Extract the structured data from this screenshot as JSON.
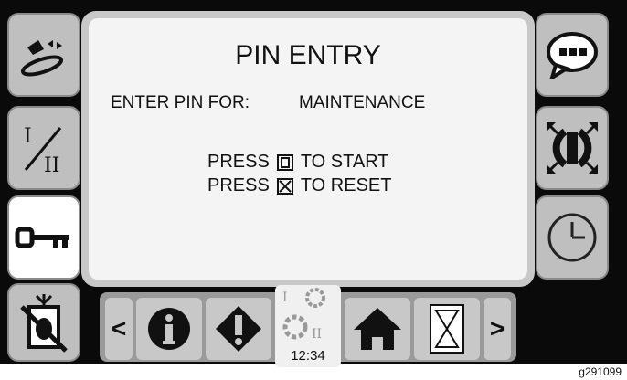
{
  "panel": {
    "title": "PIN ENTRY",
    "pin_label": "ENTER PIN FOR:",
    "pin_target": "MAINTENANCE",
    "press_word": "PRESS",
    "start_action": "TO START",
    "reset_action": "TO RESET"
  },
  "left_buttons": [
    {
      "icon": "conveyor-icon"
    },
    {
      "icon": "mode-switch-icon"
    },
    {
      "icon": "key-icon",
      "active": true
    },
    {
      "icon": "no-tamper-icon"
    }
  ],
  "right_buttons": [
    {
      "icon": "message-icon"
    },
    {
      "icon": "fullscreen-icon"
    },
    {
      "icon": "clock-icon"
    }
  ],
  "bottom_bar": {
    "prev_label": "<",
    "next_label": ">",
    "clock_time": "12:34"
  },
  "figure_id": "g291099"
}
